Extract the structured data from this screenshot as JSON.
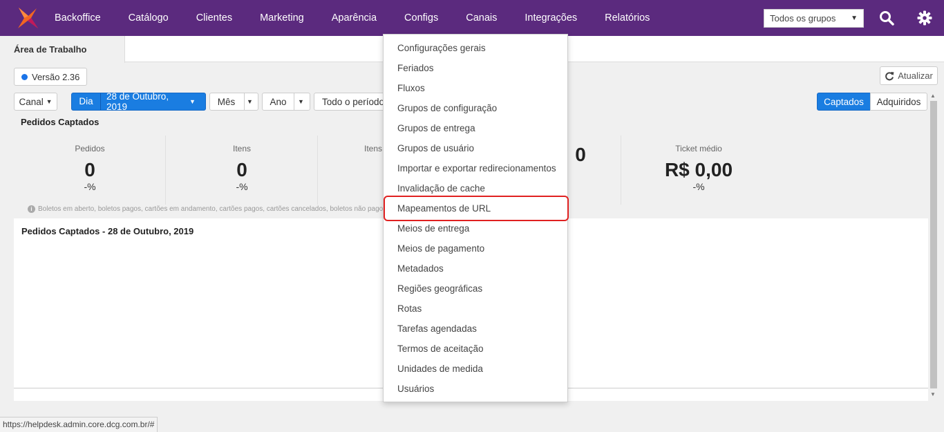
{
  "nav": {
    "items": [
      "Backoffice",
      "Catálogo",
      "Clientes",
      "Marketing",
      "Aparência",
      "Configs",
      "Canais",
      "Integrações",
      "Relatórios"
    ],
    "group_select": "Todos os grupos"
  },
  "tabs": {
    "active": "Área de Trabalho"
  },
  "version": "Versão 2.36",
  "refresh_label": "Atualizar",
  "filters": {
    "canal": "Canal",
    "dia": "Dia",
    "date": "28 de Outubro, 2019",
    "mes": "Mês",
    "ano": "Ano",
    "periodo": "Todo o período",
    "captados": "Captados",
    "adquiridos": "Adquiridos"
  },
  "summary": {
    "title": "Pedidos Captados",
    "metrics": [
      {
        "label": "Pedidos",
        "value": "0",
        "pct": "-%"
      },
      {
        "label": "Itens",
        "value": "0",
        "pct": "-%"
      },
      {
        "label": "Itens",
        "value": "",
        "pct": ""
      },
      {
        "label": "",
        "value": "0",
        "pct": ""
      },
      {
        "label": "Ticket médio",
        "value": "R$ 0,00",
        "pct": "-%"
      }
    ],
    "footnote": "Boletos em aberto, boletos pagos, cartões em andamento, cartões pagos, cartões cancelados, boletos não pagos, pedido"
  },
  "chart_panel": {
    "title": "Pedidos Captados - 28 de Outubro, 2019"
  },
  "dropdown": {
    "items": [
      "Configurações gerais",
      "Feriados",
      "Fluxos",
      "Grupos de configuração",
      "Grupos de entrega",
      "Grupos de usuário",
      "Importar e exportar redirecionamentos",
      "Invalidação de cache",
      "Mapeamentos de URL",
      "Meios de entrega",
      "Meios de pagamento",
      "Metadados",
      "Regiões geográficas",
      "Rotas",
      "Tarefas agendadas",
      "Termos de aceitação",
      "Unidades de medida",
      "Usuários"
    ],
    "highlighted_index": 8
  },
  "status_url": "https://helpdesk.admin.core.dcg.com.br/#",
  "colors": {
    "nav_bg": "#5b2a7e",
    "accent_blue": "#1a7de1",
    "highlight_red": "#e02020",
    "logo_orange": "#f26522"
  },
  "icons": [
    "logo-icon",
    "search-icon",
    "gear-icon",
    "refresh-icon",
    "info-icon"
  ]
}
